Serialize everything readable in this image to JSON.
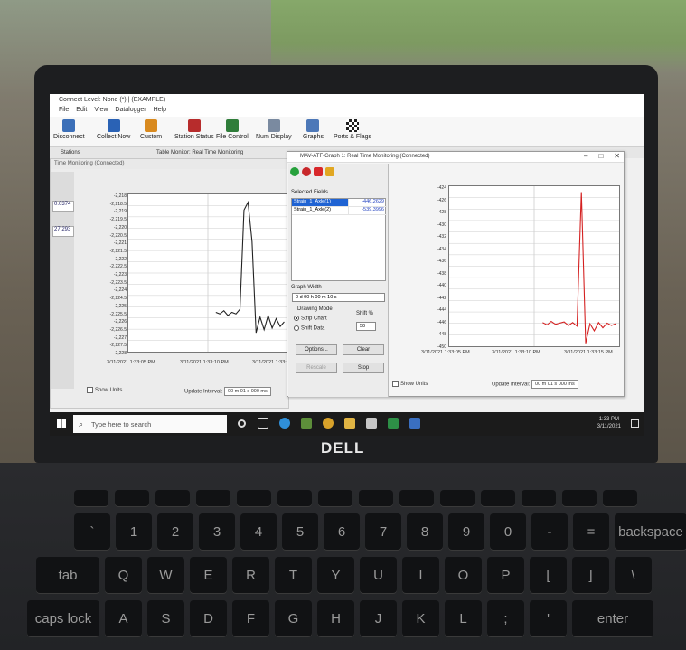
{
  "app": {
    "title": "Connect Level: None (*) | (EXAMPLE)",
    "menu": [
      "File",
      "Edit",
      "View",
      "Datalogger",
      "Help"
    ],
    "toolbar": [
      "Disconnect",
      "Collect Now",
      "Custom",
      "Station Status",
      "File Control",
      "Num Display",
      "Graphs",
      "Ports & Flags"
    ],
    "panel_tabs": {
      "stations": "Stations",
      "monitor": "Table Monitor: Real Time Monitoring"
    }
  },
  "left_window": {
    "title": "Time Monitoring (Connected)",
    "side_values": [
      "0.0374",
      "27.293"
    ],
    "y_ticks": [
      "-2,218",
      "-2,218.5",
      "-2,219",
      "-2,219.5",
      "-2,220",
      "-2,220.5",
      "-2,221",
      "-2,221.5",
      "-2,222",
      "-2,222.5",
      "-2,223",
      "-2,223.5",
      "-2,224",
      "-2,224.5",
      "-2,225",
      "-2,225.5",
      "-2,226",
      "-2,226.5",
      "-2,227",
      "-2,227.5",
      "-2,228"
    ],
    "x_ticks": [
      "3/11/2021 1:33:05 PM",
      "3/11/2021 1:33:10 PM",
      "3/11/2021 1:33:15 PM"
    ],
    "show_units": "Show Units",
    "update_interval_label": "Update Interval:",
    "update_interval_value": "00 m 01 s 000 ms"
  },
  "right_window": {
    "title": "MAV-ATF-Graph 1: Real Time Monitoring (Connected)",
    "selected_fields_label": "Selected Fields",
    "fields": [
      {
        "name": "Strain_1_Axle(1)",
        "value": "-446.2629"
      },
      {
        "name": "Strain_1_Axle(2)",
        "value": "-539.3996"
      }
    ],
    "graph_width_label": "Graph Width",
    "graph_width_value": "0 d 00 h 00 m 10 s",
    "drawing_mode_label": "Drawing Mode",
    "shift_label": "Shift %",
    "strip_chart": "Strip Chart",
    "shift_data": "Shift Data",
    "shift_value": "50",
    "buttons": {
      "options": "Options...",
      "clear": "Clear",
      "rescale": "Rescale",
      "stop": "Stop"
    },
    "show_units": "Show Units",
    "update_interval_label": "Update Interval:",
    "update_interval_value": "00 m 01 s 000 ms"
  },
  "taskbar": {
    "search_placeholder": "Type here to search",
    "time": "1:33 PM",
    "date": "3/11/2021"
  },
  "brand": "DELL",
  "chart_data": [
    {
      "type": "line",
      "ylim": [
        -2228,
        -2218
      ],
      "x_labels": [
        "3/11/2021 1:33:05 PM",
        "3/11/2021 1:33:10 PM",
        "3/11/2021 1:33:15 PM"
      ],
      "grid": true,
      "series": [
        {
          "color": "#222222",
          "values": [
            -2225.5,
            -2225.6,
            -2225.4,
            -2225.7,
            -2225.5,
            -2225.6,
            -2225.3,
            -2219.0,
            -2218.5,
            -2221.0,
            -2226.8,
            -2225.8,
            -2226.6,
            -2225.7,
            -2226.5,
            -2225.9,
            -2226.4,
            -2226.1
          ]
        }
      ]
    },
    {
      "type": "line",
      "y_ticks": [
        "-424",
        "-426",
        "-428",
        "-430",
        "-432",
        "-434",
        "-436",
        "-438",
        "-440",
        "-442",
        "-444",
        "-446",
        "-448",
        "-450"
      ],
      "ylim": [
        -450,
        -423
      ],
      "x_labels": [
        "3/11/2021 1:33:05 PM",
        "3/11/2021 1:33:10 PM",
        "3/11/2021 1:33:15 PM"
      ],
      "grid": true,
      "series": [
        {
          "color": "#d42020",
          "values": [
            -446.0,
            -446.4,
            -445.8,
            -446.3,
            -446.1,
            -445.9,
            -446.5,
            -446.0,
            -446.6,
            -424.0,
            -449.5,
            -446.2,
            -447.4,
            -446.0,
            -446.9,
            -446.1,
            -446.5,
            -446.2
          ]
        }
      ]
    }
  ],
  "keyboard": {
    "row1": [
      "`",
      "1",
      "2",
      "3",
      "4",
      "5",
      "6",
      "7",
      "8",
      "9",
      "0",
      "-",
      "=",
      "backspace"
    ],
    "row2": [
      "tab",
      "Q",
      "W",
      "E",
      "R",
      "T",
      "Y",
      "U",
      "I",
      "O",
      "P",
      "[",
      "]",
      "\\"
    ],
    "row3": [
      "caps lock",
      "A",
      "S",
      "D",
      "F",
      "G",
      "H",
      "J",
      "K",
      "L",
      ";",
      "'",
      "enter"
    ]
  }
}
